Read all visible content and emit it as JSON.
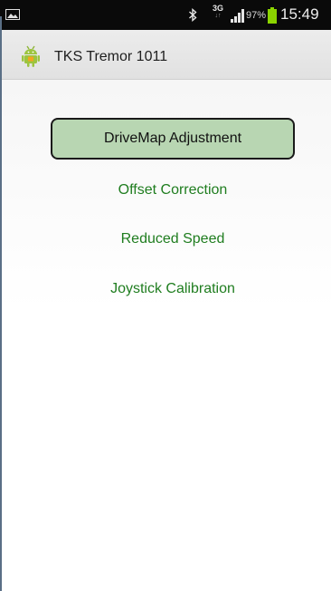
{
  "status_bar": {
    "gallery_icon": "image-icon",
    "bluetooth_icon": "bluetooth-icon",
    "network_type": "3G",
    "network_arrows": "↓↑",
    "signal_icon": "signal-icon",
    "battery_percent": "97%",
    "battery_icon": "battery-icon",
    "battery_color": "#8bd400",
    "time": "15:49"
  },
  "action_bar": {
    "app_icon": "android-icon",
    "title": "TKS Tremor 1011"
  },
  "menu": {
    "items": [
      {
        "label": "DriveMap Adjustment",
        "selected": true
      },
      {
        "label": "Offset Correction",
        "selected": false
      },
      {
        "label": "Reduced Speed",
        "selected": false
      },
      {
        "label": "Joystick Calibration",
        "selected": false
      }
    ],
    "selected_background": "#b8d6b2",
    "item_text_color": "#1f7d1f"
  }
}
